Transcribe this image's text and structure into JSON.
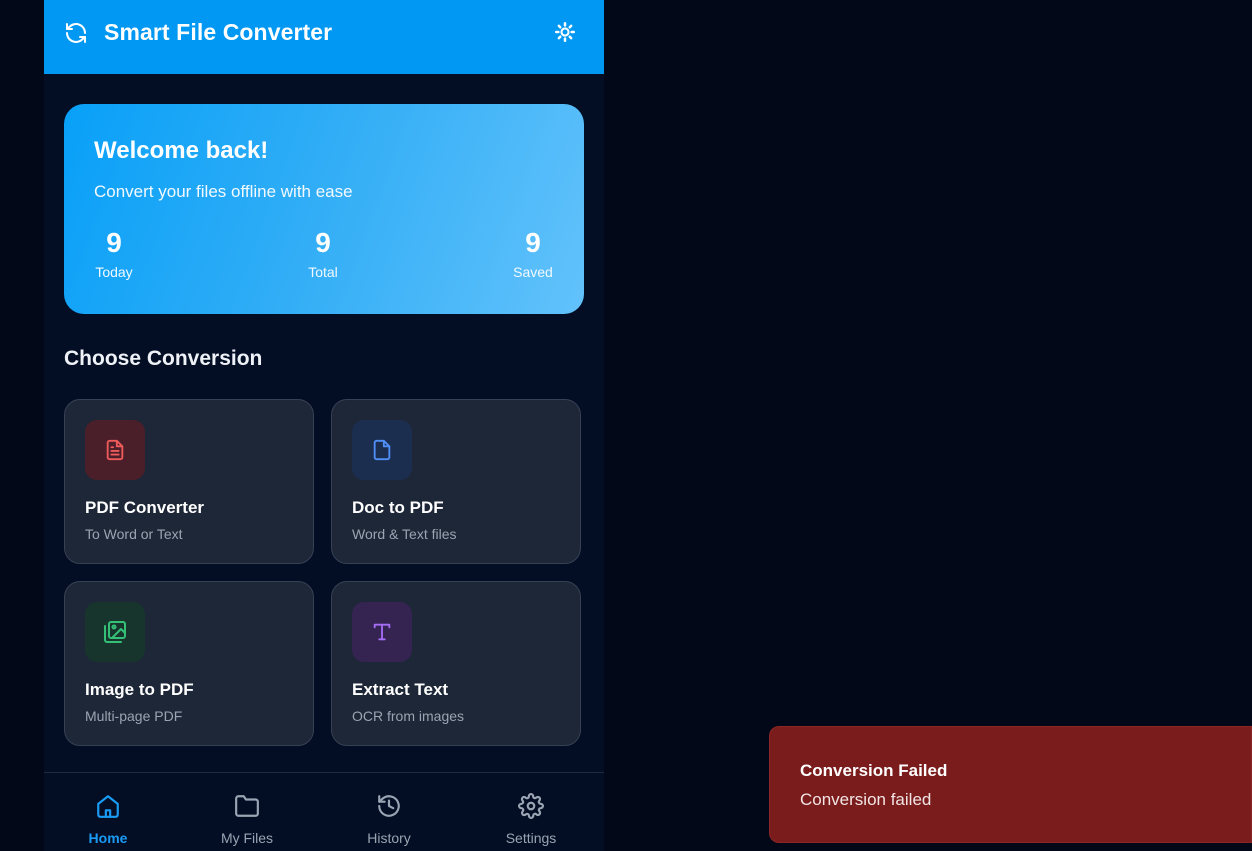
{
  "header": {
    "title": "Smart File Converter",
    "logo_icon": "refresh-icon",
    "theme_icon": "sun-icon"
  },
  "welcome": {
    "heading": "Welcome back!",
    "subtitle": "Convert your files offline with ease",
    "stats": [
      {
        "value": "9",
        "label": "Today"
      },
      {
        "value": "9",
        "label": "Total"
      },
      {
        "value": "9",
        "label": "Saved"
      }
    ]
  },
  "section": {
    "title": "Choose Conversion"
  },
  "cards": [
    {
      "name": "PDF Converter",
      "desc": "To Word or Text",
      "icon": "file-text-icon",
      "color": "#ef5b5b"
    },
    {
      "name": "Doc to PDF",
      "desc": "Word & Text files",
      "icon": "file-icon",
      "color": "#4f8ff7"
    },
    {
      "name": "Image to PDF",
      "desc": "Multi-page PDF",
      "icon": "images-icon",
      "color": "#34c177"
    },
    {
      "name": "Extract Text",
      "desc": "OCR from images",
      "icon": "type-icon",
      "color": "#a56ef5"
    }
  ],
  "nav": [
    {
      "label": "Home",
      "icon": "home-icon",
      "active": true
    },
    {
      "label": "My Files",
      "icon": "folder-icon",
      "active": false
    },
    {
      "label": "History",
      "icon": "history-icon",
      "active": false
    },
    {
      "label": "Settings",
      "icon": "settings-icon",
      "active": false
    }
  ],
  "toast": {
    "title": "Conversion Failed",
    "message": "Conversion failed"
  },
  "colors": {
    "accent": "#0098f2",
    "background": "#030d24",
    "error": "#7a1c1c"
  }
}
